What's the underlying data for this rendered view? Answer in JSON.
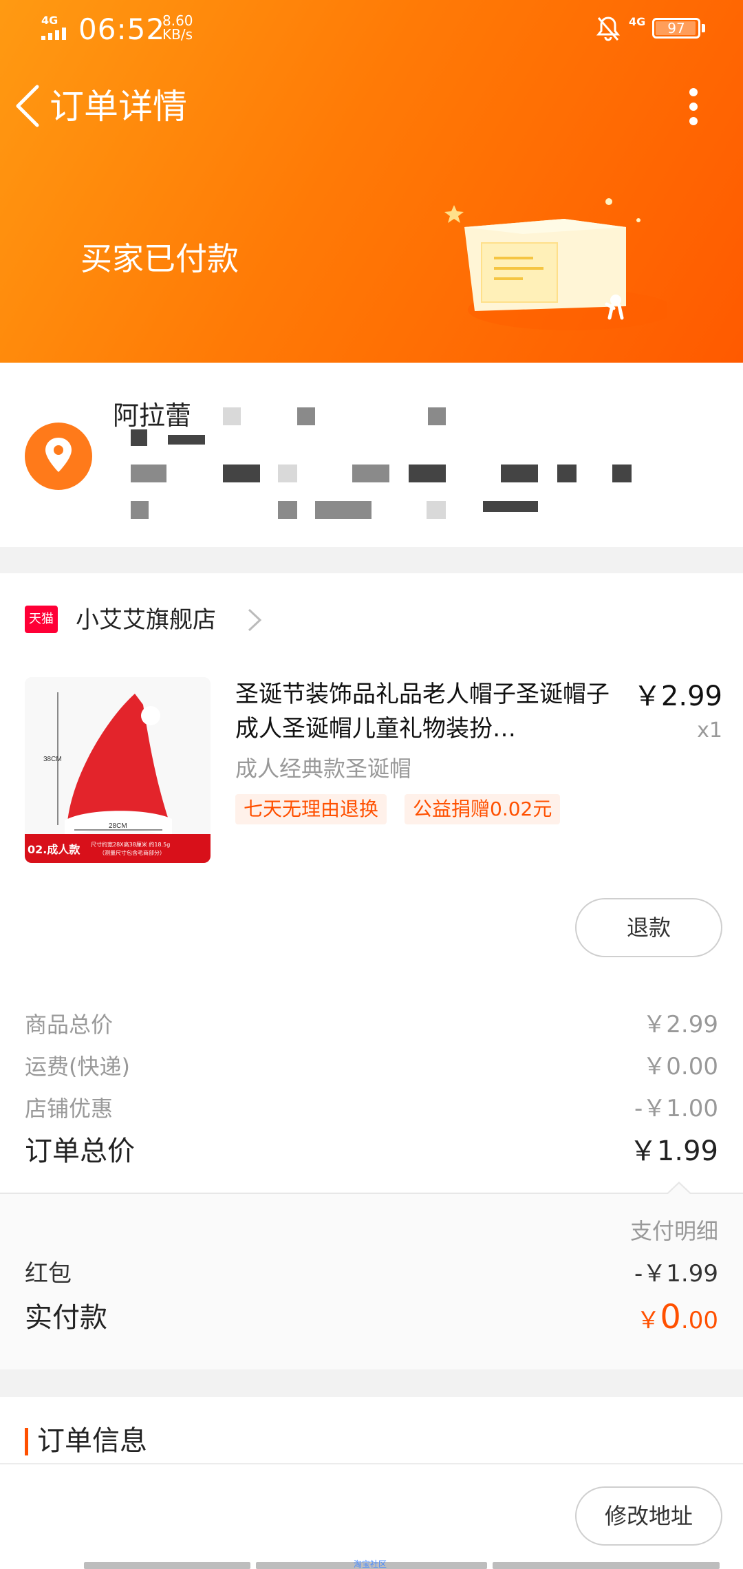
{
  "status_bar": {
    "network_left": "4G",
    "time": "06:52",
    "speed_value": "8.60",
    "speed_unit": "KB/s",
    "network_right": "4G",
    "battery": "97",
    "battery_level": 0.97
  },
  "nav": {
    "title": "订单详情"
  },
  "order": {
    "status": "买家已付款"
  },
  "address": {
    "name": "阿拉蕾"
  },
  "shop": {
    "badge": "天猫",
    "name": "小艾艾旗舰店"
  },
  "product": {
    "title": "圣诞节装饰品礼品老人帽子圣诞帽子成人圣诞帽儿童礼物装扮…",
    "price": "￥2.99",
    "quantity": "x1",
    "spec": "成人经典款圣诞帽",
    "tags": [
      "七天无理由退换",
      "公益捐赠0.02元"
    ],
    "image_text": {
      "height": "38CM",
      "width": "28CM",
      "variant": "02.成人款",
      "note_line1": "尺寸约宽28X高38厘米 约18.5g",
      "note_line2": "（测量尺寸包含毛商部分）"
    }
  },
  "refund_button": "退款",
  "summary": [
    {
      "label": "商品总价",
      "value": "￥2.99"
    },
    {
      "label": "运费(快递)",
      "value": "￥0.00"
    },
    {
      "label": "店铺优惠",
      "value": "-￥1.00"
    }
  ],
  "total": {
    "label": "订单总价",
    "value": "￥1.99"
  },
  "payment": {
    "detail_label": "支付明细",
    "red_packet_label": "红包",
    "red_packet_value": "-￥1.99",
    "paid_label": "实付款",
    "paid_currency": "￥",
    "paid_integer": "0",
    "paid_decimal": ".00"
  },
  "order_info": {
    "title": "订单信息"
  },
  "modify_address_button": "修改地址",
  "bottom_link": "淘宝社区",
  "colors": {
    "accent": "#ff5000",
    "header_start": "#ff9a12",
    "header_end": "#ff5a00",
    "tmall_red": "#ff0036"
  }
}
